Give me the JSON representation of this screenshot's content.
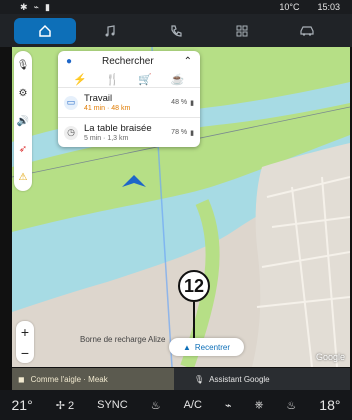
{
  "status": {
    "temperature": "10°C",
    "time": "15:03"
  },
  "nav": {
    "tabs": [
      {
        "name": "home",
        "label": ""
      },
      {
        "name": "music",
        "label": ""
      },
      {
        "name": "phone",
        "label": ""
      },
      {
        "name": "apps",
        "label": ""
      },
      {
        "name": "car",
        "label": ""
      }
    ]
  },
  "search": {
    "title": "Rechercher",
    "categories": [
      "charging",
      "restaurant",
      "shopping",
      "coffee"
    ],
    "items": [
      {
        "name": "Travail",
        "eta": "41 min · 48 km",
        "battery": "48 %"
      },
      {
        "name": "La table braisée",
        "eta": "5 min · 1,3 km",
        "battery": "78 %"
      }
    ]
  },
  "map": {
    "label": "Borne de recharge Alize",
    "recenter": "Recentrer",
    "callout": "12",
    "brand": "Google"
  },
  "media": {
    "track": "Comme l'aigle · Meak",
    "assistant": "Assistant Google"
  },
  "climate": {
    "driver_temp": "21°",
    "fan": "2",
    "sync": "SYNC",
    "ac": "A/C",
    "passenger_temp": "18°"
  },
  "colors": {
    "accent": "#0d6fb8",
    "water": "#a7dbe4",
    "park": "#b6df86",
    "route": "#6ea7f5"
  }
}
